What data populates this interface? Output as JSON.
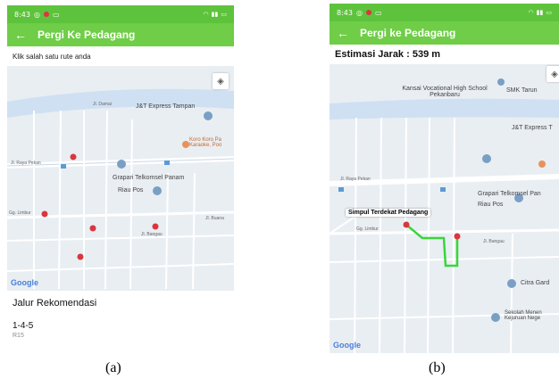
{
  "screen_a": {
    "status_time": "8:43",
    "app_title": "Pergi Ke Pedagang",
    "back_icon": "back-arrow-icon",
    "instruction": "Klik salah satu rute anda",
    "map_labels": {
      "jnt": "J&T Express Tampan",
      "koro": "Koro Koro Pa Karaoke, Poo",
      "grapari": "Grapari Telkomsel Panam",
      "riaupos": "Riau Pos",
      "raya_pekan": "Jl. Raya Pekan",
      "limbur": "Gg. Limbur",
      "bangau": "Jl. Bangau",
      "buana": "Jl. Buana",
      "damai": "Jl. Damai",
      "google": "Google"
    },
    "panel": {
      "title": "Jalur Rekomendasi",
      "route": "1-4-5",
      "code": "R15"
    },
    "caption": "(a)"
  },
  "screen_b": {
    "status_time": "8:43",
    "app_title": "Pergi ke Pedagang",
    "back_icon": "back-arrow-icon",
    "estimate": "Estimasi Jarak : 539 m",
    "map_labels": {
      "kansai": "Kansai Vocational High School Pekanbaru",
      "smk": "SMK Tarun",
      "jnt": "J&T Express T",
      "grapari": "Grapari Telkomsel Pan",
      "riaupos": "Riau Pos",
      "callout": "Simpul Terdekat Pedagang",
      "raya_pekan": "Jl. Raya Pekan",
      "limbur": "Gg. Limbur",
      "bangau": "Jl. Bangau",
      "citra": "Citra Gard",
      "sekolah": "Sekolah Menen Kejuruan Nege",
      "google": "Google"
    },
    "caption": "(b)"
  },
  "colors": {
    "appbar": "#6fcd47",
    "statusbar": "#5ec33c",
    "route": "#38d63a",
    "pin": "#d9363e",
    "poi": "#7a9fc4"
  }
}
